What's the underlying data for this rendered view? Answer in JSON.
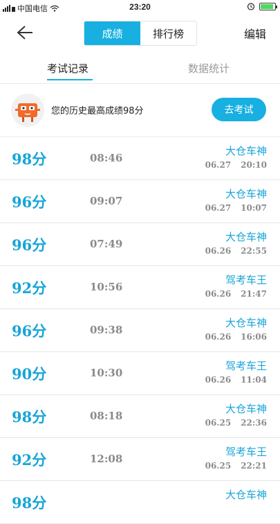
{
  "status_bar": {
    "carrier": "中国电信",
    "time": "23:20"
  },
  "header": {
    "segments": [
      "成绩",
      "排行榜"
    ],
    "edit_label": "编辑"
  },
  "tabs": [
    "考试记录",
    "数据统计"
  ],
  "banner": {
    "text": "您的历史最高成绩98分",
    "button_label": "去考试"
  },
  "records": [
    {
      "score": "98分",
      "duration": "08:46",
      "tag": "大仓车神",
      "date": "06.27",
      "time": "20:10"
    },
    {
      "score": "96分",
      "duration": "09:07",
      "tag": "大仓车神",
      "date": "06.27",
      "time": "10:07"
    },
    {
      "score": "96分",
      "duration": "07:49",
      "tag": "大仓车神",
      "date": "06.26",
      "time": "22:55"
    },
    {
      "score": "92分",
      "duration": "10:56",
      "tag": "驾考车王",
      "date": "06.26",
      "time": "21:47"
    },
    {
      "score": "96分",
      "duration": "09:38",
      "tag": "大仓车神",
      "date": "06.26",
      "time": "16:06"
    },
    {
      "score": "90分",
      "duration": "10:30",
      "tag": "驾考车王",
      "date": "06.26",
      "time": "11:04"
    },
    {
      "score": "98分",
      "duration": "08:18",
      "tag": "大仓车神",
      "date": "06.25",
      "time": "22:36"
    },
    {
      "score": "92分",
      "duration": "12:08",
      "tag": "驾考车王",
      "date": "06.25",
      "time": "22:21"
    },
    {
      "score": "98分",
      "duration": "",
      "tag": "大仓车神",
      "date": "",
      "time": ""
    }
  ],
  "colors": {
    "accent": "#17b0e0",
    "score": "#17a5d8",
    "muted": "#8a8a8a"
  },
  "icons": [
    "signal-icon",
    "wifi-icon",
    "alarm-icon",
    "battery-icon",
    "back-arrow-icon"
  ]
}
